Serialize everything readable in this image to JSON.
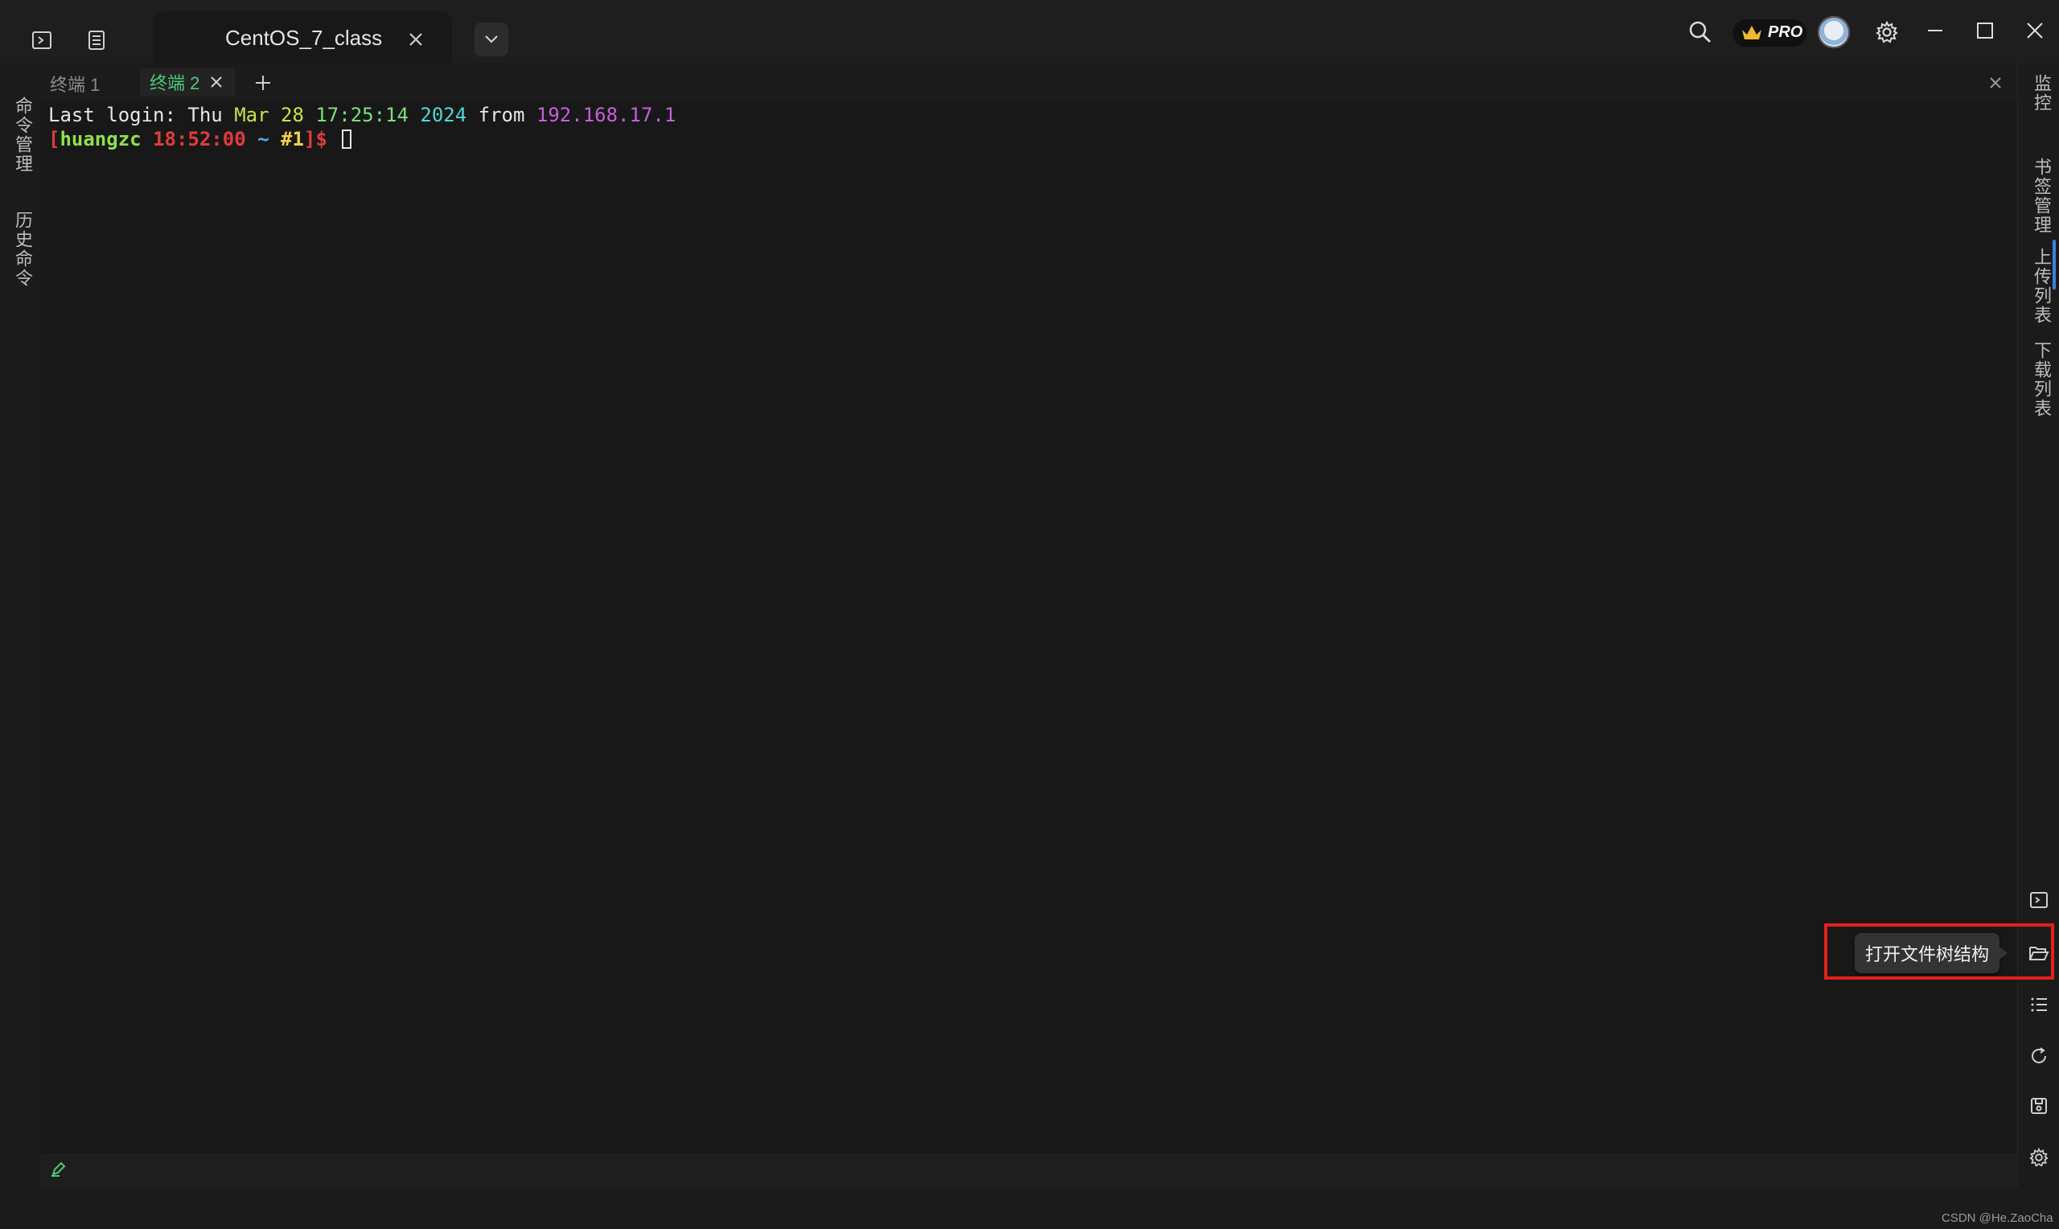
{
  "titlebar": {
    "session_tab_title": "CentOS_7_class",
    "pro_badge": "PRO"
  },
  "left_rail": {
    "items": [
      {
        "label": "命令管理"
      },
      {
        "label": "历史命令"
      }
    ]
  },
  "right_rail": {
    "items": [
      {
        "label": "监控"
      },
      {
        "label": "书签管理"
      },
      {
        "label": "上传列表"
      },
      {
        "label": "下载列表"
      }
    ],
    "icons": [
      "terminal-icon",
      "folder-open-icon",
      "list-icon",
      "refresh-icon",
      "save-icon",
      "settings-icon"
    ]
  },
  "subtabs": [
    {
      "label": "终端 1"
    },
    {
      "label": "终端 2"
    }
  ],
  "terminal": {
    "line1": {
      "prefix": "Last login: Thu ",
      "month": "Mar",
      "day": "28",
      "time": "17:25:14",
      "year": "2024",
      "from": "from",
      "ip": "192.168.17.1"
    },
    "line2": {
      "open": "[",
      "user": "huangzc",
      "time": "18:52:00",
      "dir": "~",
      "num": "#1",
      "close": "]$"
    }
  },
  "tooltip": {
    "text": "打开文件树结构"
  },
  "watermark": "CSDN @He.ZaoCha",
  "colors": {
    "background": "#181818",
    "accent_green": "#4cc97a",
    "highlight_red": "#e3201b"
  }
}
